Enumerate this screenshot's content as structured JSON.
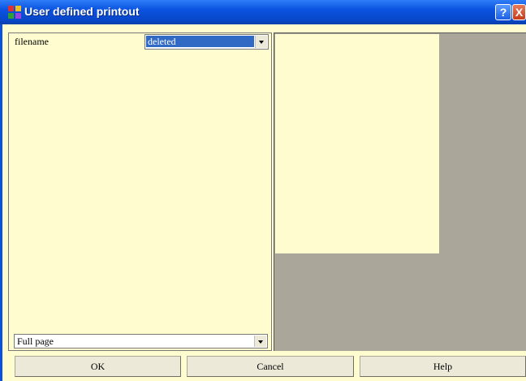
{
  "window": {
    "title": "User defined printout",
    "help_button": "?",
    "close_button": "X"
  },
  "form": {
    "filename_label": "filename",
    "filename_value": "deleted",
    "scope_value": "Full page"
  },
  "buttons": {
    "ok": "OK",
    "cancel": "Cancel",
    "help": "Help"
  },
  "colors": {
    "panel_background": "#fffccf",
    "preview_background": "#aba69a",
    "selection": "#316ac5",
    "titlebar": "#0a52e0"
  }
}
